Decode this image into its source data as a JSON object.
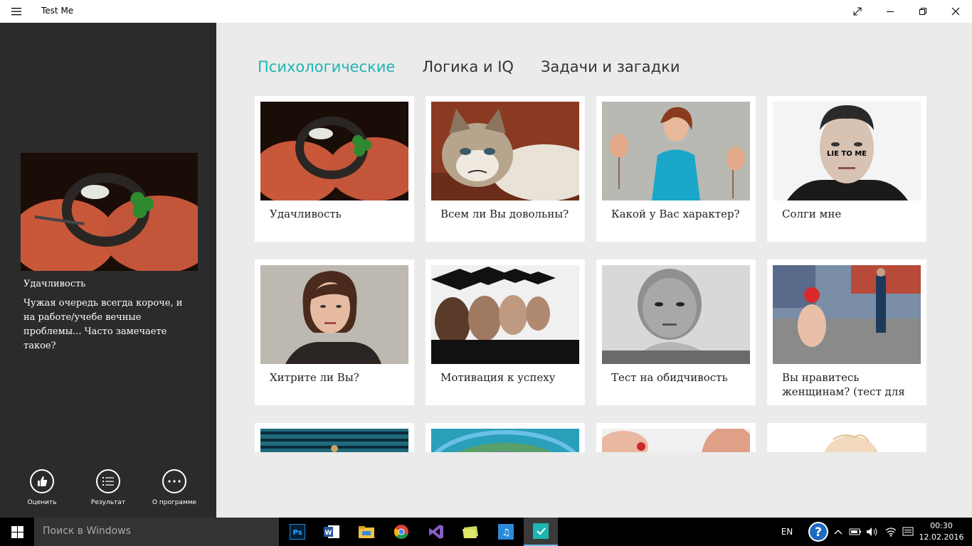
{
  "window": {
    "title": "Test Me"
  },
  "sidebar": {
    "selected_title": "Удачливость",
    "selected_description": "Чужая очередь всегда короче, и на работе/учебе вечные проблемы... Часто замечаете такое?",
    "actions": [
      {
        "label": "Оценить",
        "icon": "thumbs-up-icon"
      },
      {
        "label": "Результат",
        "icon": "list-icon"
      },
      {
        "label": "О программе",
        "icon": "more-icon"
      }
    ]
  },
  "tabs": [
    {
      "label": "Психологические",
      "active": true
    },
    {
      "label": "Логика и IQ",
      "active": false
    },
    {
      "label": "Задачи и загадки",
      "active": false
    }
  ],
  "tests": [
    {
      "title": "Удачливость",
      "image": "horseshoe-clover-photo"
    },
    {
      "title": "Всем ли Вы довольны?",
      "image": "grumpy-cat-photo"
    },
    {
      "title": "Какой у Вас характер?",
      "image": "woman-with-masks-photo"
    },
    {
      "title": "Солги мне",
      "image": "lie-to-me-poster"
    },
    {
      "title": "Хитрите ли Вы?",
      "image": "thinking-woman-photo"
    },
    {
      "title": "Мотивация к успеху",
      "image": "graduates-photo"
    },
    {
      "title": "Тест на обидчивость",
      "image": "angry-child-photo"
    },
    {
      "title": "Вы нравитесь женщинам? (тест для",
      "image": "girl-on-street-photo"
    },
    {
      "title": "",
      "image": "stadium-seats-photo"
    },
    {
      "title": "",
      "image": "colorful-circle-photo"
    },
    {
      "title": "",
      "image": "hand-photo"
    },
    {
      "title": "",
      "image": "baby-photo"
    }
  ],
  "taskbar": {
    "search_placeholder": "Поиск в Windows",
    "apps": [
      "photoshop-icon",
      "word-icon",
      "file-explorer-icon",
      "chrome-icon",
      "visual-studio-icon",
      "folder-icon",
      "music-app-icon",
      "test-me-app-icon"
    ],
    "language": "EN",
    "time": "00:30",
    "date": "12.02.2016"
  },
  "colors": {
    "accent": "#1fb5b2",
    "sidebar_bg": "#2b2b2b",
    "main_bg": "#ebebeb"
  }
}
